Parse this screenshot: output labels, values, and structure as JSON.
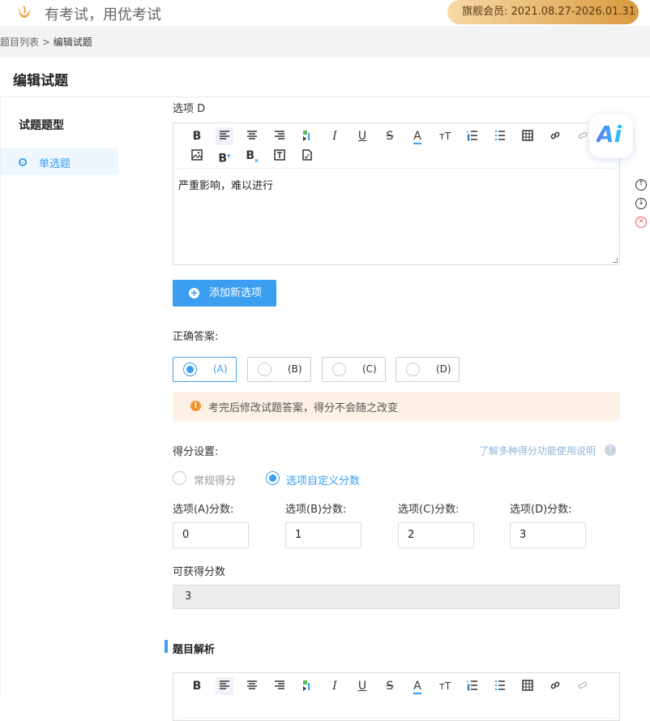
{
  "header": {
    "slogan": "有考试，用优考试",
    "membership": "旗舰会员:  2021.08.27-2026.01.31"
  },
  "breadcrumb": {
    "parent": "题目列表",
    "separator": " > ",
    "current": "编辑试题"
  },
  "page": {
    "title": "编辑试题"
  },
  "sidebar": {
    "heading": "试题题型",
    "items": [
      {
        "label": "单选题",
        "selected": true
      }
    ]
  },
  "option_editor": {
    "label": "选项 D",
    "content": "严重影响，难以进行",
    "toolbar_icons": [
      "bold-icon",
      "align-left-icon",
      "align-center-icon",
      "align-right-icon",
      "format-painter-icon",
      "italic-icon",
      "underline-icon",
      "strikethrough-icon",
      "font-color-icon",
      "font-size-icon",
      "ordered-list-icon",
      "unordered-list-icon",
      "table-icon",
      "link-icon",
      "unlink-icon",
      "image-icon",
      "superscript-icon",
      "subscript-icon",
      "text-box-icon",
      "formula-icon"
    ]
  },
  "add_option_button": "添加新选项",
  "correct_answer": {
    "label": "正确答案:",
    "options": [
      "(A)",
      "(B)",
      "(C)",
      "(D)"
    ],
    "selected": "(A)"
  },
  "warning": "考完后修改试题答案，得分不会随之改变",
  "scoring": {
    "label": "得分设置:",
    "help_link": "了解多种得分功能使用说明",
    "modes": [
      "常规得分",
      "选项自定义分数"
    ],
    "selected_mode": "选项自定义分数",
    "option_scores": [
      {
        "label": "选项(A)分数:",
        "value": "0"
      },
      {
        "label": "选项(B)分数:",
        "value": "1"
      },
      {
        "label": "选项(C)分数:",
        "value": "2"
      },
      {
        "label": "选项(D)分数:",
        "value": "3"
      }
    ],
    "total_label": "可获得分数",
    "total_value": "3"
  },
  "analysis": {
    "label": "题目解析"
  },
  "colors": {
    "accent": "#3a9ff0",
    "warning": "#f0952e",
    "member_gold": "#d99a3f"
  }
}
